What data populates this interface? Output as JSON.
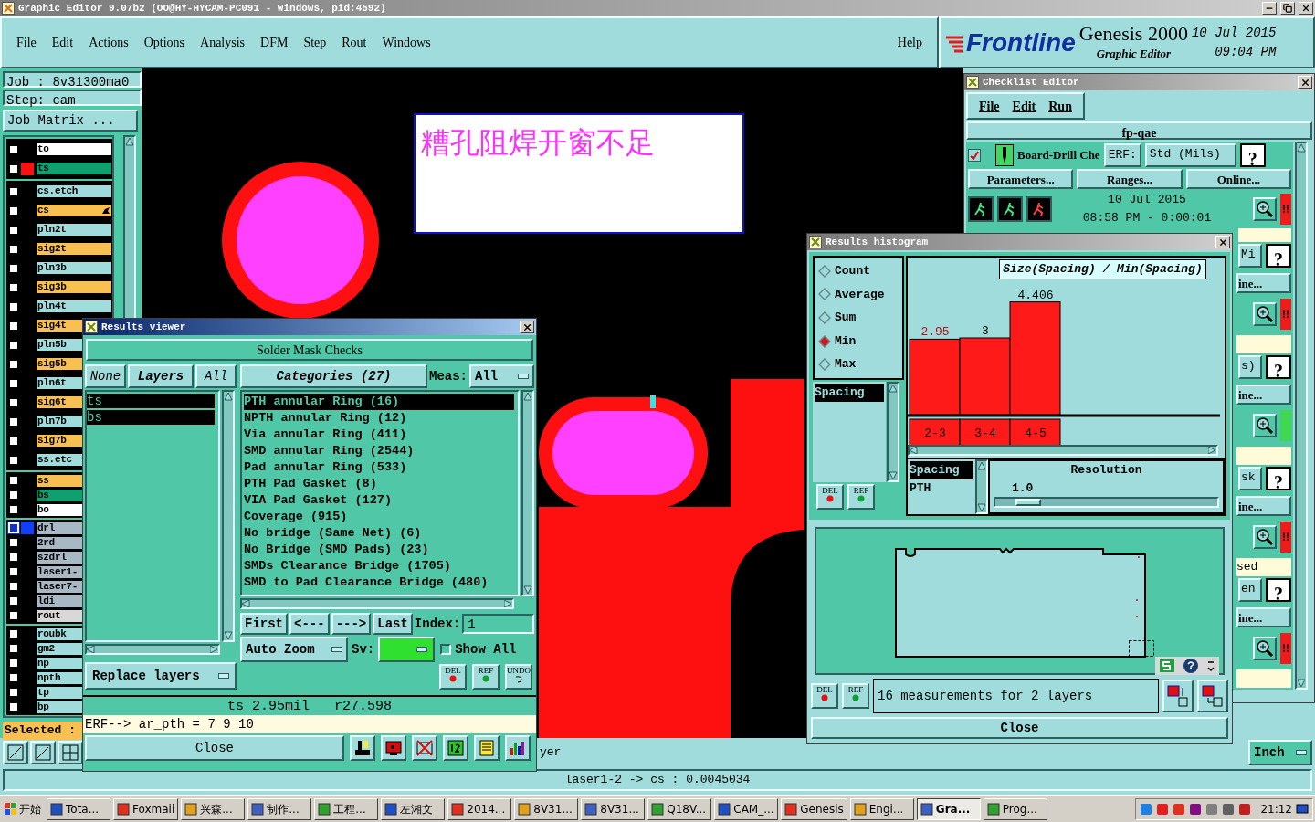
{
  "main_window": {
    "title": "Graphic Editor 9.07b2 (OO@HY-HYCAM-PC091 - Windows, pid:4592)",
    "menu": [
      "File",
      "Edit",
      "Actions",
      "Options",
      "Analysis",
      "DFM",
      "Step",
      "Rout",
      "Windows"
    ],
    "help": "Help",
    "brand": {
      "logo": "Frontline",
      "product": "Genesis 2000",
      "subtitle": "Graphic Editor",
      "date": "10 Jul 2015",
      "time": "09:04 PM"
    }
  },
  "job_panel": {
    "job": "Job : 8v31300ma0",
    "step": "Step: cam",
    "matrix_button": "Job Matrix ...",
    "groups": [
      {
        "layers": [
          {
            "name": "to",
            "color": "#ffffff",
            "checked": false,
            "active": false
          },
          {
            "name": "ts",
            "color": "#10a070",
            "checked": false,
            "active": false,
            "marker": {
              "color": "#ff1010"
            }
          }
        ]
      },
      {
        "layers": [
          {
            "name": "cs.etch",
            "color": "#a0dcdc",
            "checked": false,
            "active": false
          },
          {
            "name": "cs",
            "color": "#f8c050",
            "checked": false,
            "active": true
          },
          {
            "name": "pln2t",
            "color": "#a0dcdc",
            "checked": false,
            "active": false
          },
          {
            "name": "sig2t",
            "color": "#f8c050",
            "checked": false,
            "active": false
          },
          {
            "name": "pln3b",
            "color": "#a0dcdc",
            "checked": false,
            "active": false
          },
          {
            "name": "sig3b",
            "color": "#f8c050",
            "checked": false,
            "active": false
          },
          {
            "name": "pln4t",
            "color": "#a0dcdc",
            "checked": false,
            "active": false
          },
          {
            "name": "sig4t",
            "color": "#f8c050",
            "checked": false,
            "active": false
          },
          {
            "name": "pln5b",
            "color": "#a0dcdc",
            "checked": false,
            "active": false
          },
          {
            "name": "sig5b",
            "color": "#f8c050",
            "checked": false,
            "active": false
          },
          {
            "name": "pln6t",
            "color": "#a0dcdc",
            "checked": false,
            "active": false
          },
          {
            "name": "sig6t",
            "color": "#f8c050",
            "checked": false,
            "active": false
          },
          {
            "name": "pln7b",
            "color": "#a0dcdc",
            "checked": false,
            "active": false
          },
          {
            "name": "sig7b",
            "color": "#f8c050",
            "checked": false,
            "active": false
          },
          {
            "name": "ss.etc",
            "color": "#a0dcdc",
            "checked": false,
            "active": false
          }
        ]
      },
      {
        "layers": [
          {
            "name": "ss",
            "color": "#f8c050",
            "checked": false,
            "active": false
          },
          {
            "name": "bs",
            "color": "#10a070",
            "checked": false,
            "active": false
          },
          {
            "name": "bo",
            "color": "#ffffff",
            "checked": false,
            "active": false
          }
        ]
      },
      {
        "layers": [
          {
            "name": "drl",
            "color": "#a8b8c4",
            "checked": true,
            "active": false,
            "marker": {
              "color": "#1040ff"
            }
          },
          {
            "name": "2rd",
            "color": "#a8b8c4",
            "checked": false,
            "active": false
          },
          {
            "name": "szdrl",
            "color": "#a8b8c4",
            "checked": false,
            "active": false
          },
          {
            "name": "laser1-",
            "color": "#a8b8c4",
            "checked": false,
            "active": false
          },
          {
            "name": "laser7-",
            "color": "#a8b8c4",
            "checked": false,
            "active": false
          },
          {
            "name": "ldi",
            "color": "#a8b8c4",
            "checked": false,
            "active": false
          },
          {
            "name": "rout",
            "color": "#d8d8d8",
            "checked": false,
            "active": false
          }
        ]
      },
      {
        "layers": [
          {
            "name": "roubk",
            "color": "#a0dcdc",
            "checked": false,
            "active": false
          },
          {
            "name": "gm2",
            "color": "#a0dcdc",
            "checked": false,
            "active": false
          },
          {
            "name": "np",
            "color": "#a0dcdc",
            "checked": false,
            "active": false
          },
          {
            "name": "npth",
            "color": "#a0dcdc",
            "checked": false,
            "active": false
          },
          {
            "name": "tp",
            "color": "#a0dcdc",
            "checked": false,
            "active": false
          },
          {
            "name": "bp",
            "color": "#a0dcdc",
            "checked": false,
            "active": false
          }
        ]
      }
    ],
    "selected": "Selected :"
  },
  "canvas": {
    "note": "糟孔阻焊开窗不足"
  },
  "bottom_bar": {
    "fragment": "yer",
    "units": "Inch"
  },
  "status_bar": "laser1-2 -> cs : 0.0045034",
  "results_viewer": {
    "title": "Results viewer",
    "header": "Solder Mask Checks",
    "layer_buttons": [
      "None",
      "Layers",
      "All"
    ],
    "layers": [
      {
        "name": "ts",
        "selected": true
      },
      {
        "name": "bs",
        "selected": true
      }
    ],
    "categories_button": "Categories (27)",
    "meas_label": "Meas:",
    "meas_value": "All",
    "categories": [
      {
        "label": "PTH annular Ring (16)",
        "selected": true
      },
      {
        "label": "NPTH annular Ring (12)",
        "selected": false
      },
      {
        "label": "Via annular Ring (411)",
        "selected": false
      },
      {
        "label": "SMD annular Ring (2544)",
        "selected": false
      },
      {
        "label": "Pad annular Ring (533)",
        "selected": false
      },
      {
        "label": "PTH Pad Gasket (8)",
        "selected": false
      },
      {
        "label": "VIA Pad Gasket (127)",
        "selected": false
      },
      {
        "label": "Coverage (915)",
        "selected": false
      },
      {
        "label": "No bridge (Same Net) (6)",
        "selected": false
      },
      {
        "label": "No Bridge (SMD Pads) (23)",
        "selected": false
      },
      {
        "label": "SMDs Clearance Bridge (1705)",
        "selected": false
      },
      {
        "label": "SMD to Pad Clearance Bridge (480)",
        "selected": false
      }
    ],
    "nav": [
      "First",
      "<---",
      "--->",
      "Last"
    ],
    "index_label": "Index:",
    "index_value": "1",
    "zoom_mode": "Auto Zoom",
    "sv_label": "Sv:",
    "show_all": {
      "label": "Show All",
      "checked": false
    },
    "replace": "Replace layers",
    "tools": [
      "DEL",
      "REF",
      "UNDO"
    ],
    "measure": "ts 2.95mil   r27.598",
    "erf": "ERF--> ar_pth = 7 9 10",
    "close": "Close"
  },
  "checklist_editor": {
    "title": "Checklist Editor",
    "menu": [
      "File",
      "Edit",
      "Run"
    ],
    "name": "fp-qae",
    "first": {
      "checked": true,
      "label": "Board-Drill Che",
      "erf": "ERF:",
      "erf_value": "Std (Mils)",
      "help": "?",
      "buttons": [
        "Parameters...",
        "Ranges...",
        "Online..."
      ],
      "date": "10 Jul 2015",
      "time": "08:58 PM - 0:00:01",
      "status": {
        "color": "#ee1c1c",
        "mark": "!!"
      }
    },
    "rows": [
      {
        "field": "Mi",
        "help": "?",
        "online": "ine...",
        "status": {
          "color": "#ee1c1c",
          "mark": "!!"
        }
      },
      {
        "field": "s)",
        "help": "?",
        "online": "ine...",
        "status": {
          "color": "#40d850"
        }
      },
      {
        "field": "sk",
        "help": "?",
        "online": "ine...",
        "status": {
          "color": "#ee1c1c",
          "mark": "!!"
        },
        "note": "sed"
      },
      {
        "field": "en",
        "help": "?",
        "online": "ine...",
        "status": {
          "color": "#ee1c1c",
          "mark": "!!"
        }
      }
    ]
  },
  "histogram": {
    "title": "Results histogram",
    "modes": [
      {
        "label": "Count",
        "selected": false
      },
      {
        "label": "Average",
        "selected": false
      },
      {
        "label": "Sum",
        "selected": false
      },
      {
        "label": "Min",
        "selected": true
      },
      {
        "label": "Max",
        "selected": false
      }
    ],
    "attributes": [
      {
        "label": "Spacing",
        "selected": true
      }
    ],
    "attribute_tools": [
      "DEL",
      "REF"
    ],
    "chart_data": {
      "type": "bar",
      "title": "Size(Spacing) / Min(Spacing)",
      "categories": [
        "2-3",
        "3-4",
        "4-5"
      ],
      "values": [
        2.95,
        3,
        4.406
      ],
      "data_labels": true
    },
    "value_labels": [
      {
        "text": "2.95",
        "highlight": true
      },
      {
        "text": "3",
        "highlight": false
      },
      {
        "text": "4.406",
        "highlight": false
      }
    ],
    "fields": [
      {
        "label": "Spacing",
        "selected": true
      },
      {
        "label": "PTH",
        "selected": false
      }
    ],
    "resolution_label": "Resolution",
    "resolution_value": "1.0",
    "resolution": {
      "level": 0.1
    },
    "footer_tools": [
      "DEL",
      "REF"
    ],
    "message": "16 measurements for 2 layers",
    "close": "Close"
  },
  "taskbar": {
    "start": "开始",
    "items": [
      {
        "label": "Tota...",
        "selected": false
      },
      {
        "label": "Foxmail",
        "selected": false
      },
      {
        "label": "兴森...",
        "selected": false
      },
      {
        "label": "制作...",
        "selected": false
      },
      {
        "label": "工程...",
        "selected": false
      },
      {
        "label": "左湘文",
        "selected": false
      },
      {
        "label": "2014...",
        "selected": false
      },
      {
        "label": "8V31...",
        "selected": false
      },
      {
        "label": "8V31...",
        "selected": false
      },
      {
        "label": "Q18V...",
        "selected": false
      },
      {
        "label": "CAM_...",
        "selected": false
      },
      {
        "label": "Genesis",
        "selected": false
      },
      {
        "label": "Engi...",
        "selected": false
      },
      {
        "label": "Gra...",
        "selected": true
      },
      {
        "label": "Prog...",
        "selected": false
      }
    ],
    "clock": "21:12"
  }
}
